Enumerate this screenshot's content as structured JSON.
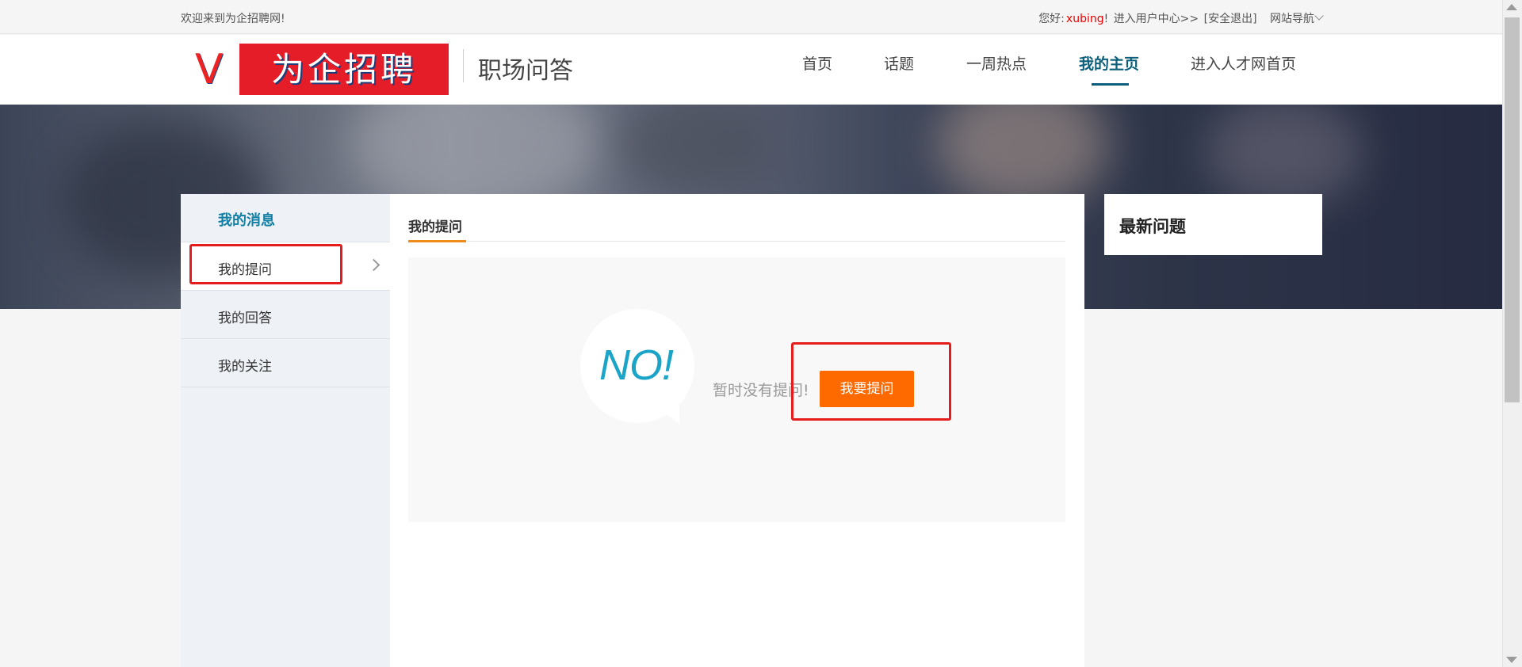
{
  "topbar": {
    "welcome": "欢迎来到为企招聘网!",
    "greeting": "您好:",
    "username": "xubing",
    "exclaim": "!",
    "user_center": "进入用户中心>>",
    "logout": "[安全退出]",
    "site_nav": "网站导航"
  },
  "header": {
    "logo_letter": "V",
    "logo_text": "为企招聘",
    "subtitle": "职场问答",
    "nav": [
      "首页",
      "话题",
      "一周热点",
      "我的主页",
      "进入人才网首页"
    ],
    "active_nav": "我的主页"
  },
  "sidebar": {
    "title": "我的消息",
    "items": [
      {
        "label": "我的提问",
        "selected": true
      },
      {
        "label": "我的回答",
        "selected": false
      },
      {
        "label": "我的关注",
        "selected": false
      }
    ]
  },
  "main": {
    "tab": "我的提问",
    "empty_icon_text": "NO!",
    "empty_message": "暂时没有提问!",
    "ask_button": "我要提问"
  },
  "right_panel": {
    "title": "最新问题"
  },
  "colors": {
    "accent": "#0c5e7a",
    "button": "#ff6a00",
    "highlight": "#e51c1c",
    "logo_red": "#e41d28",
    "no_icon": "#1aa5c8"
  }
}
